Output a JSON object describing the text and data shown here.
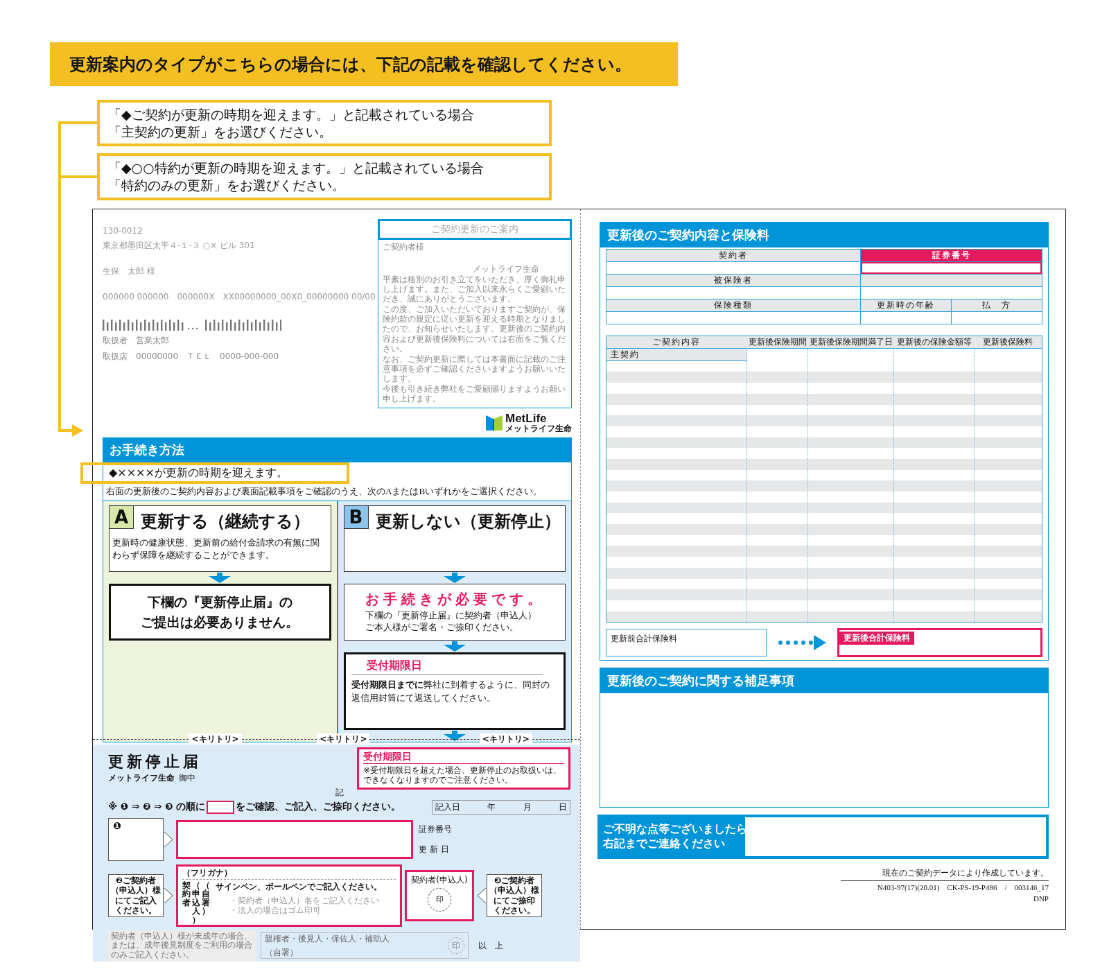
{
  "banner": "更新案内のタイプがこちらの場合には、下記の記載を確認してください。",
  "callouts": [
    {
      "lines": [
        "「◆ご契約が更新の時期を迎えます。」と記載されている場合",
        "「主契約の更新」をお選びください。"
      ]
    },
    {
      "lines": [
        "「◆○○特約が更新の時期を迎えます。」と記載されている場合",
        "「特約のみの更新」をお選びください。"
      ]
    }
  ],
  "letter": {
    "postal": "130-0012",
    "address": "東京都墨田区太平４-１-３ ○× ビル 301",
    "recipient": "生保　太郎 様",
    "codes": "000000 000000　000000X　XX00000000_00X0_00000000 00/00",
    "handler": "取扱者　営業太郎",
    "branch": "取扱店　00000000　ＴＥＬ　0000-000-000"
  },
  "notice": {
    "title": "ご契約更新のご案内",
    "salutation": "ご契約者様",
    "sender": "メットライフ生命",
    "paragraphs": [
      "平素は格別のお引き立てをいただき、厚く御礼申し上げます。また、ご加入以来永らくご愛顧いただき、誠にありがとうございます。",
      "この度、ご加入いただいておりますご契約が、保険約款の規定に従い更新を迎える時期となりましたので、お知らせいたします。更新後のご契約内容および更新後保険料については右面をご覧ください。",
      "なお、ご契約更新に際しては本書面に記載のご注意事項を必ずご確認くださいますようお願いいたします。",
      "今後も引き続き弊社をご愛顧賜りますようお願い申し上げます。"
    ]
  },
  "logo": {
    "name": "MetLife",
    "subtitle": "メットライフ生命"
  },
  "procedure": {
    "title": "お手続き方法",
    "highlighted_notice": "◆××××が更新の時期を迎えます。",
    "instruction": "右面の更新後のご契約内容および裏面記載事項をご確認のうえ、次のAまたはBいずれかをご選択ください。",
    "options": [
      {
        "kind": "continue",
        "color": "#eef3dc",
        "letter": "A",
        "title": "更新する（継続する）",
        "description": "更新時の健康状態、更新前の給付金請求の有無に関わらず保障を継続することができます。",
        "result_lines": [
          "下欄の『更新停止届』の",
          "ご提出は必要ありません。"
        ]
      },
      {
        "kind": "stop",
        "color": "#dcebf8",
        "letter": "B",
        "title": "更新しない（更新停止）",
        "required": "お手続きが必要です。",
        "required_lines": [
          "下欄の『更新停止届』に契約者（申込人）",
          "ご本人様がご署名・ご捺印ください。"
        ],
        "deadline_title": "受付期限日",
        "deadline_text": "**受付期限日までに**弊社に到着するように、同封の返信用封筒にて返送してください。"
      }
    ]
  },
  "cut_labels": [
    "<キリトリ>",
    "<キリトリ>",
    "<キリトリ>"
  ],
  "form": {
    "title": "更新停止届",
    "addressee": "メットライフ生命",
    "honorific": "御中",
    "deadline_title": "受付期限日",
    "deadline_note_lines": [
      "※受付期限日を超えた場合、更新停止のお取扱いは、",
      "できなくなりますのでご注意ください。"
    ],
    "ki": "記",
    "instruction_before": "※ ❶ ⇒ ❷ ⇒ ❸ の順に",
    "instruction_after": "をご確認、ご記入、ご捺印ください。",
    "date_labels": [
      "記入日",
      "年",
      "月",
      "日"
    ],
    "step1": {
      "marker": "❶",
      "fields": [
        "証券番号",
        "更 新 日"
      ]
    },
    "step2": {
      "lines": [
        "❷ご契約者",
        "（申込人）様",
        "にてご記入",
        "ください。"
      ]
    },
    "signature": {
      "furigana": "（フリガナ）",
      "pen_note": "サインペン、ボールペンでご記入ください。",
      "label_columns": [
        "契約者",
        "（申込人）",
        "（自署）"
      ],
      "hints": [
        "・契約者（申込人）名をご記入ください",
        "・法人の場合はゴム印可"
      ]
    },
    "seal": {
      "label": "契約者(申込人)",
      "mark": "印"
    },
    "step3": {
      "lines": [
        "❸ご契約者",
        "（申込人）様",
        "にてご捺印",
        "ください。"
      ]
    },
    "guardian": {
      "note": "契約者（申込人）様が未成年の場合、または、成年後見制度をご利用の場合のみご記入ください。",
      "roles": "親権者・後見人・保佐人・補助人",
      "sign": "（自署）",
      "mark": "印"
    },
    "end": "以　上"
  },
  "contract": {
    "title": "更新後のご契約内容と保険料",
    "contractor": "契約者",
    "policy_number": "証券番号",
    "insured": "被保険者",
    "insurance_type": "保険種類",
    "age": "更新時の年齢",
    "payment": "払　方",
    "columns": [
      "ご契約内容",
      "更新後保険期間",
      "更新後保険期間満了日",
      "更新後の保険金額等",
      "更新後保険料"
    ],
    "first_row": "主契約",
    "total_before": "更新前合計保険料",
    "total_after": "更新後合計保険料"
  },
  "supplement": {
    "title": "更新後のご契約に関する補足事項"
  },
  "contact": {
    "lines": [
      "ご不明な点等ございましたら",
      "右記までご連絡ください"
    ]
  },
  "footer": {
    "note": "現在のご契約データにより作成しています。",
    "code": "N403-97(17)(20.01)　CK-PS-19-P486　/　003146_17",
    "printer": "DNP"
  }
}
